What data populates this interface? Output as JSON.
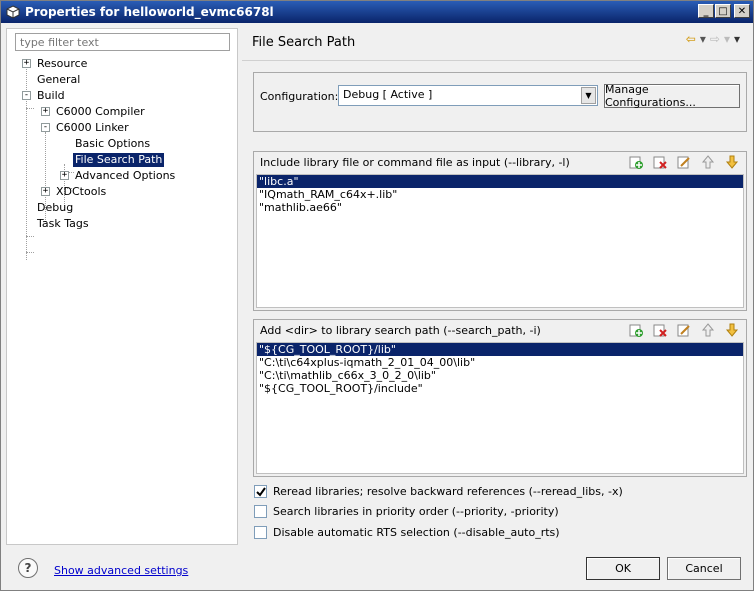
{
  "window": {
    "title": "Properties for helloworld_evmc6678l",
    "min_label": "_",
    "max_label": "□",
    "close_label": "✕"
  },
  "sidebar": {
    "filter_placeholder": "type filter text",
    "items": [
      {
        "label": "Resource",
        "toggle": "+"
      },
      {
        "label": "General"
      },
      {
        "label": "Build",
        "toggle": "-"
      },
      {
        "label": "C6000 Compiler",
        "toggle": "+"
      },
      {
        "label": "C6000 Linker",
        "toggle": "-"
      },
      {
        "label": "Basic Options"
      },
      {
        "label": "File Search Path",
        "selected": true
      },
      {
        "label": "Advanced Options",
        "toggle": "+"
      },
      {
        "label": "XDCtools",
        "toggle": "+"
      },
      {
        "label": "Debug"
      },
      {
        "label": "Task Tags"
      }
    ]
  },
  "page": {
    "title": "File Search Path",
    "nav": {
      "back": "⇦",
      "dropdown": "▾",
      "forward": "⇨",
      "menu": "▾"
    }
  },
  "configuration": {
    "label": "Configuration:",
    "value": "Debug  [ Active ]",
    "manage_button": "Manage Configurations..."
  },
  "library_panel": {
    "header": "Include library file or command file as input (--library, -l)",
    "items": [
      "\"libc.a\"",
      "\"IQmath_RAM_c64x+.lib\"",
      "\"mathlib.ae66\""
    ],
    "selected_index": 0
  },
  "search_path_panel": {
    "header": "Add <dir> to library search path (--search_path, -i)",
    "items": [
      "\"${CG_TOOL_ROOT}/lib\"",
      "\"C:\\ti\\c64xplus-iqmath_2_01_04_00\\lib\"",
      "\"C:\\ti\\mathlib_c66x_3_0_2_0\\lib\"",
      "\"${CG_TOOL_ROOT}/include\""
    ],
    "selected_index": 0
  },
  "tools": [
    "add-icon",
    "delete-icon",
    "edit-icon",
    "move-up-icon",
    "move-down-icon"
  ],
  "options": [
    {
      "label": "Reread libraries; resolve backward references (--reread_libs, -x)",
      "checked": true
    },
    {
      "label": "Search libraries in priority order (--priority, -priority)",
      "checked": false
    },
    {
      "label": "Disable automatic RTS selection (--disable_auto_rts)",
      "checked": false
    }
  ],
  "footer": {
    "help": "?",
    "advanced_link": "Show advanced settings",
    "ok": "OK",
    "cancel": "Cancel"
  },
  "colors": {
    "selection": "#0a246a",
    "titlebar": "#0a246a",
    "link": "#0000cc"
  }
}
